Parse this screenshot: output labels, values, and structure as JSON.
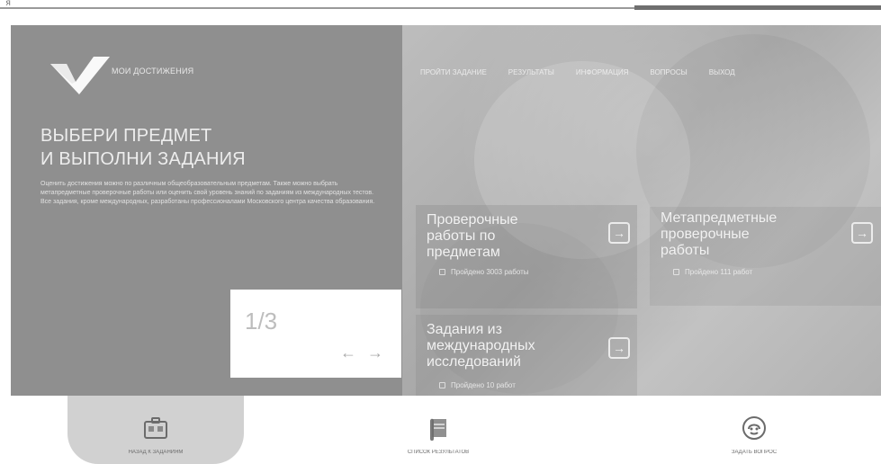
{
  "topbar": {
    "left_text": "я"
  },
  "header": {
    "brand_text": "МОИ ДОСТИЖЕНИЯ",
    "nav_items": [
      "ПРОЙТИ ЗАДАНИЕ",
      "РЕЗУЛЬТАТЫ",
      "ИНФОРМАЦИЯ",
      "ВОПРОСЫ",
      "ВЫХОД"
    ]
  },
  "hero": {
    "headline_line1": "ВЫБЕРИ ПРЕДМЕТ",
    "headline_line2": "И ВЫПОЛНИ ЗАДАНИЯ",
    "description": "Оценить достижения можно по различным общеобразовательным предметам. Также можно выбрать метапредметные проверочные работы или оценить свой уровень знаний по заданиям из международных тестов. Все задания, кроме международных, разработаны профессионалами Московского центра качества образования.",
    "slider_counter": "1/3",
    "slider_prev": "←",
    "slider_next": "→"
  },
  "cards": [
    {
      "title_line1": "Проверочные",
      "title_line2": "работы по",
      "title_line3": "предметам",
      "sub": "Пройдено 3003 работы",
      "arrow": "→"
    },
    {
      "title_line1": "Метапредметные",
      "title_line2": "проверочные",
      "title_line3": "работы",
      "sub": "Пройдено 111 работ",
      "arrow": "→"
    },
    {
      "title_line1": "Задания из",
      "title_line2": "международных",
      "title_line3": "исследований",
      "sub": "Пройдено 10 работ",
      "arrow": "→"
    }
  ],
  "bottom_tabs": [
    {
      "label": "НАЗАД К ЗАДАНИЯМ"
    },
    {
      "label": "СПИСОК РЕЗУЛЬТАТОВ"
    },
    {
      "label": "ЗАДАТЬ ВОПРОС"
    }
  ],
  "colors": {
    "left_panel": "#8f8f8f",
    "right_panel": "#b9b9b9",
    "white": "#ffffff",
    "highlight": "#d1d1d1"
  }
}
